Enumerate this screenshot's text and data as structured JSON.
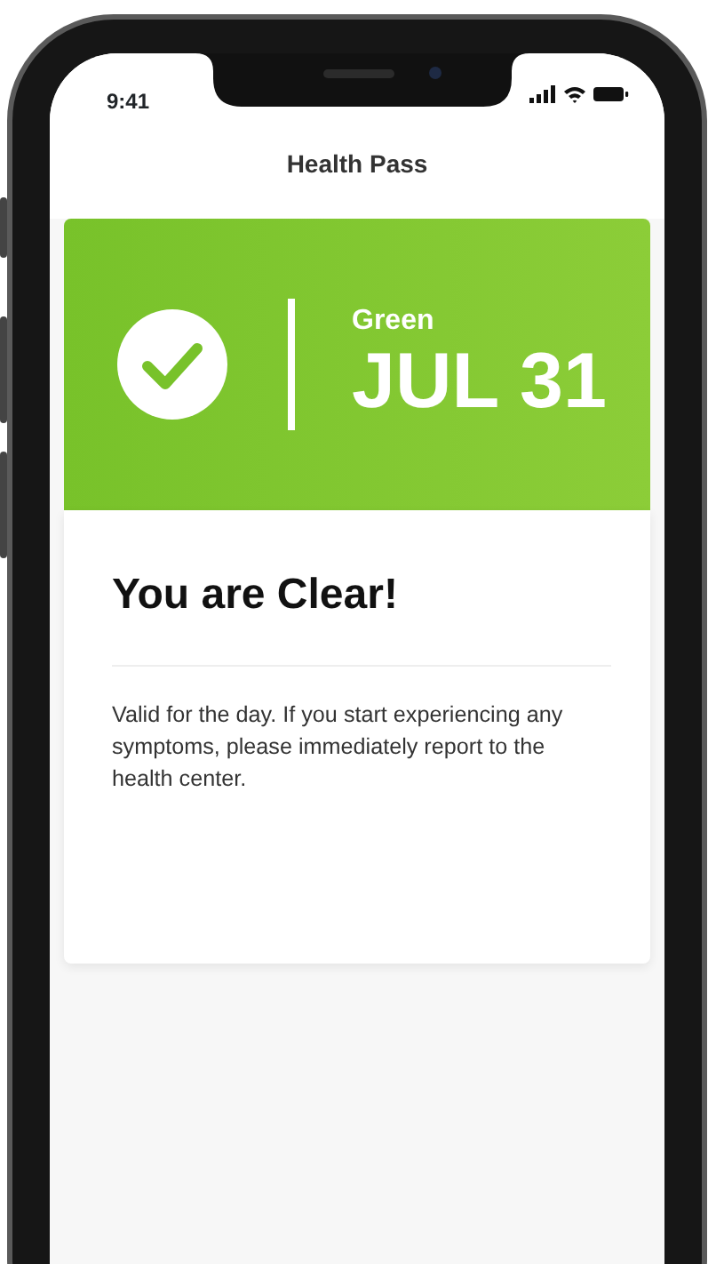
{
  "status_bar": {
    "time": "9:41"
  },
  "header": {
    "title": "Health Pass"
  },
  "pass": {
    "status": "Green",
    "date": "JUL 31",
    "cleared": true
  },
  "result": {
    "heading": "You are Clear!",
    "message": "Valid for the day. If you start experiencing any symptoms, please immediately report to the health center."
  }
}
